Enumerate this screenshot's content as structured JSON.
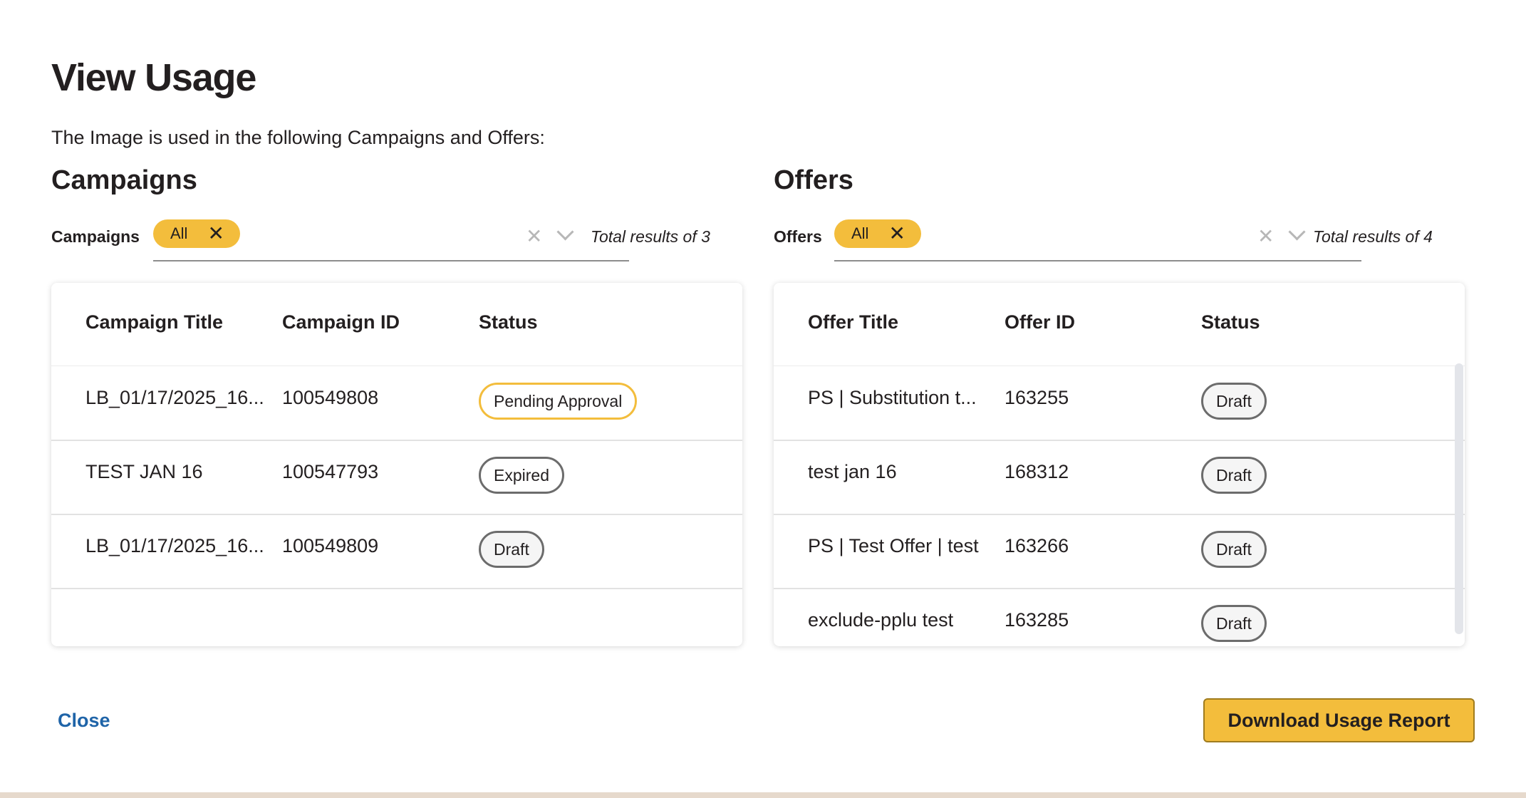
{
  "modal": {
    "title": "View Usage",
    "subtitle": "The Image is used in the following Campaigns and Offers:"
  },
  "campaigns": {
    "section_title": "Campaigns",
    "filter_label": "Campaigns",
    "chip_label": "All",
    "total_results": "Total results of 3",
    "columns": [
      "Campaign Title",
      "Campaign ID",
      "Status"
    ],
    "rows": [
      {
        "title": "LB_01/17/2025_16...",
        "id": "100549808",
        "status": "Pending Approval"
      },
      {
        "title": "TEST JAN 16",
        "id": "100547793",
        "status": "Expired"
      },
      {
        "title": "LB_01/17/2025_16...",
        "id": "100549809",
        "status": "Draft"
      }
    ]
  },
  "offers": {
    "section_title": "Offers",
    "filter_label": "Offers",
    "chip_label": "All",
    "total_results": "Total results of 4",
    "columns": [
      "Offer Title",
      "Offer ID",
      "Status"
    ],
    "rows": [
      {
        "title": "PS | Substitution t...",
        "id": "163255",
        "status": "Draft"
      },
      {
        "title": "test jan 16",
        "id": "168312",
        "status": "Draft"
      },
      {
        "title": "PS | Test Offer | test",
        "id": "163266",
        "status": "Draft"
      },
      {
        "title": "exclude-pplu test",
        "id": "163285",
        "status": "Draft"
      }
    ]
  },
  "icons": {
    "chip_remove": "close-icon",
    "clear": "clear-icon",
    "dropdown": "chevron-down-icon"
  },
  "footer": {
    "close_label": "Close",
    "download_label": "Download Usage Report"
  },
  "colors": {
    "accent": "#f3bd3c",
    "link": "#1f64a8",
    "text": "#231f20",
    "badge_border": "#6c6c6c"
  }
}
